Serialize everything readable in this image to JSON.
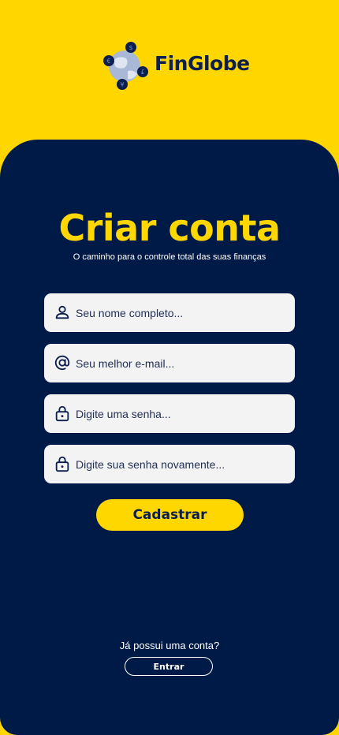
{
  "brand": {
    "name": "FinGlobe",
    "logo_icon": "globe-with-currency-icons",
    "currency_symbols": [
      "$",
      "€",
      "£",
      "¥"
    ]
  },
  "colors": {
    "yellow": "#ffd700",
    "navy": "#001a47",
    "field_bg": "#f3f3f4",
    "text_dark": "#0b1e4d"
  },
  "signup": {
    "title": "Criar conta",
    "subtitle": "O caminho para o controle total das suas finanças",
    "fields": [
      {
        "icon": "user-icon",
        "placeholder": "Seu nome completo...",
        "value": ""
      },
      {
        "icon": "at-sign-icon",
        "placeholder": "Seu melhor e-mail...",
        "value": ""
      },
      {
        "icon": "lock-icon",
        "placeholder": "Digite uma senha...",
        "value": ""
      },
      {
        "icon": "lock-icon",
        "placeholder": "Digite sua senha novamente...",
        "value": ""
      }
    ],
    "submit_label": "Cadastrar"
  },
  "login": {
    "question": "Já possui uma conta?",
    "button_label": "Entrar"
  }
}
